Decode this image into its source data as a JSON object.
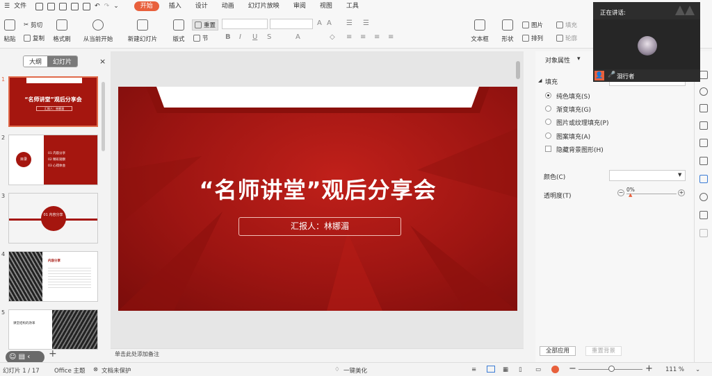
{
  "menu": {
    "file": "文件",
    "tabs": [
      "开始",
      "插入",
      "设计",
      "动画",
      "幻灯片放映",
      "审阅",
      "视图",
      "工具"
    ],
    "active_tab": "开始"
  },
  "ribbon": {
    "paste": "粘贴",
    "cut": "剪切",
    "copy": "复制",
    "format_painter": "格式刷",
    "play_from_current": "从当前开始",
    "new_slide": "新建幻灯片",
    "layout": "版式",
    "reset": "重置",
    "section": "节",
    "text_box": "文本框",
    "shape": "形状",
    "picture": "图片",
    "fill": "填充",
    "arrange": "排列",
    "outline": "轮廓"
  },
  "left_panel": {
    "tab_outline": "大纲",
    "tab_slides": "幻灯片",
    "slides": [
      {
        "num": "1",
        "title": "“名师讲堂”观后分享会",
        "sub": "汇报人：林娜湄"
      },
      {
        "num": "2",
        "label": "目录",
        "items": [
          "01 内容分享",
          "02 精彩观察",
          "03 心得体会"
        ]
      },
      {
        "num": "3",
        "label": "01 内容分享"
      },
      {
        "num": "4",
        "label": "内容分享"
      },
      {
        "num": "5",
        "label": "课堂结构的改革"
      }
    ]
  },
  "slide": {
    "title": "“名师讲堂”观后分享会",
    "subtitle": "汇报人：林娜湄"
  },
  "notes_placeholder": "单击此处添加备注",
  "right_panel": {
    "title": "对象属性",
    "fill_label": "填充",
    "fill_options": [
      "纯色填充(S)",
      "渐变填充(G)",
      "图片或纹理填充(P)",
      "图案填充(A)"
    ],
    "hide_bg": "隐藏背景图形(H)",
    "color_label": "颜色(C)",
    "transparency_label": "透明度(T)",
    "transparency_value": "0%",
    "apply_all": "全部应用",
    "reset_bg": "重置背景"
  },
  "speaker": {
    "title": "正在讲话:",
    "name": "洄行者"
  },
  "status": {
    "slide_count": "幻灯片 1 / 17",
    "theme": "Office 主题",
    "doc_protect": "文档未保护",
    "beautify": "一键美化",
    "zoom": "111 %"
  },
  "colors": {
    "accent": "#e8603c",
    "slide_red": "#a5160f"
  }
}
